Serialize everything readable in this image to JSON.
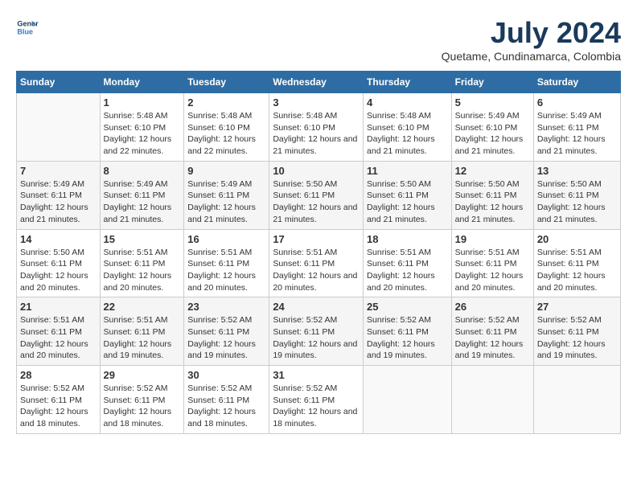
{
  "logo": {
    "line1": "General",
    "line2": "Blue"
  },
  "title": "July 2024",
  "subtitle": "Quetame, Cundinamarca, Colombia",
  "days_of_week": [
    "Sunday",
    "Monday",
    "Tuesday",
    "Wednesday",
    "Thursday",
    "Friday",
    "Saturday"
  ],
  "weeks": [
    [
      {
        "day": "",
        "sunrise": "",
        "sunset": "",
        "daylight": ""
      },
      {
        "day": "1",
        "sunrise": "5:48 AM",
        "sunset": "6:10 PM",
        "daylight": "12 hours and 22 minutes."
      },
      {
        "day": "2",
        "sunrise": "5:48 AM",
        "sunset": "6:10 PM",
        "daylight": "12 hours and 22 minutes."
      },
      {
        "day": "3",
        "sunrise": "5:48 AM",
        "sunset": "6:10 PM",
        "daylight": "12 hours and 21 minutes."
      },
      {
        "day": "4",
        "sunrise": "5:48 AM",
        "sunset": "6:10 PM",
        "daylight": "12 hours and 21 minutes."
      },
      {
        "day": "5",
        "sunrise": "5:49 AM",
        "sunset": "6:10 PM",
        "daylight": "12 hours and 21 minutes."
      },
      {
        "day": "6",
        "sunrise": "5:49 AM",
        "sunset": "6:11 PM",
        "daylight": "12 hours and 21 minutes."
      }
    ],
    [
      {
        "day": "7",
        "sunrise": "5:49 AM",
        "sunset": "6:11 PM",
        "daylight": "12 hours and 21 minutes."
      },
      {
        "day": "8",
        "sunrise": "5:49 AM",
        "sunset": "6:11 PM",
        "daylight": "12 hours and 21 minutes."
      },
      {
        "day": "9",
        "sunrise": "5:49 AM",
        "sunset": "6:11 PM",
        "daylight": "12 hours and 21 minutes."
      },
      {
        "day": "10",
        "sunrise": "5:50 AM",
        "sunset": "6:11 PM",
        "daylight": "12 hours and 21 minutes."
      },
      {
        "day": "11",
        "sunrise": "5:50 AM",
        "sunset": "6:11 PM",
        "daylight": "12 hours and 21 minutes."
      },
      {
        "day": "12",
        "sunrise": "5:50 AM",
        "sunset": "6:11 PM",
        "daylight": "12 hours and 21 minutes."
      },
      {
        "day": "13",
        "sunrise": "5:50 AM",
        "sunset": "6:11 PM",
        "daylight": "12 hours and 21 minutes."
      }
    ],
    [
      {
        "day": "14",
        "sunrise": "5:50 AM",
        "sunset": "6:11 PM",
        "daylight": "12 hours and 20 minutes."
      },
      {
        "day": "15",
        "sunrise": "5:51 AM",
        "sunset": "6:11 PM",
        "daylight": "12 hours and 20 minutes."
      },
      {
        "day": "16",
        "sunrise": "5:51 AM",
        "sunset": "6:11 PM",
        "daylight": "12 hours and 20 minutes."
      },
      {
        "day": "17",
        "sunrise": "5:51 AM",
        "sunset": "6:11 PM",
        "daylight": "12 hours and 20 minutes."
      },
      {
        "day": "18",
        "sunrise": "5:51 AM",
        "sunset": "6:11 PM",
        "daylight": "12 hours and 20 minutes."
      },
      {
        "day": "19",
        "sunrise": "5:51 AM",
        "sunset": "6:11 PM",
        "daylight": "12 hours and 20 minutes."
      },
      {
        "day": "20",
        "sunrise": "5:51 AM",
        "sunset": "6:11 PM",
        "daylight": "12 hours and 20 minutes."
      }
    ],
    [
      {
        "day": "21",
        "sunrise": "5:51 AM",
        "sunset": "6:11 PM",
        "daylight": "12 hours and 20 minutes."
      },
      {
        "day": "22",
        "sunrise": "5:51 AM",
        "sunset": "6:11 PM",
        "daylight": "12 hours and 19 minutes."
      },
      {
        "day": "23",
        "sunrise": "5:52 AM",
        "sunset": "6:11 PM",
        "daylight": "12 hours and 19 minutes."
      },
      {
        "day": "24",
        "sunrise": "5:52 AM",
        "sunset": "6:11 PM",
        "daylight": "12 hours and 19 minutes."
      },
      {
        "day": "25",
        "sunrise": "5:52 AM",
        "sunset": "6:11 PM",
        "daylight": "12 hours and 19 minutes."
      },
      {
        "day": "26",
        "sunrise": "5:52 AM",
        "sunset": "6:11 PM",
        "daylight": "12 hours and 19 minutes."
      },
      {
        "day": "27",
        "sunrise": "5:52 AM",
        "sunset": "6:11 PM",
        "daylight": "12 hours and 19 minutes."
      }
    ],
    [
      {
        "day": "28",
        "sunrise": "5:52 AM",
        "sunset": "6:11 PM",
        "daylight": "12 hours and 18 minutes."
      },
      {
        "day": "29",
        "sunrise": "5:52 AM",
        "sunset": "6:11 PM",
        "daylight": "12 hours and 18 minutes."
      },
      {
        "day": "30",
        "sunrise": "5:52 AM",
        "sunset": "6:11 PM",
        "daylight": "12 hours and 18 minutes."
      },
      {
        "day": "31",
        "sunrise": "5:52 AM",
        "sunset": "6:11 PM",
        "daylight": "12 hours and 18 minutes."
      },
      {
        "day": "",
        "sunrise": "",
        "sunset": "",
        "daylight": ""
      },
      {
        "day": "",
        "sunrise": "",
        "sunset": "",
        "daylight": ""
      },
      {
        "day": "",
        "sunrise": "",
        "sunset": "",
        "daylight": ""
      }
    ]
  ],
  "labels": {
    "sunrise_prefix": "Sunrise: ",
    "sunset_prefix": "Sunset: ",
    "daylight_prefix": "Daylight: "
  }
}
